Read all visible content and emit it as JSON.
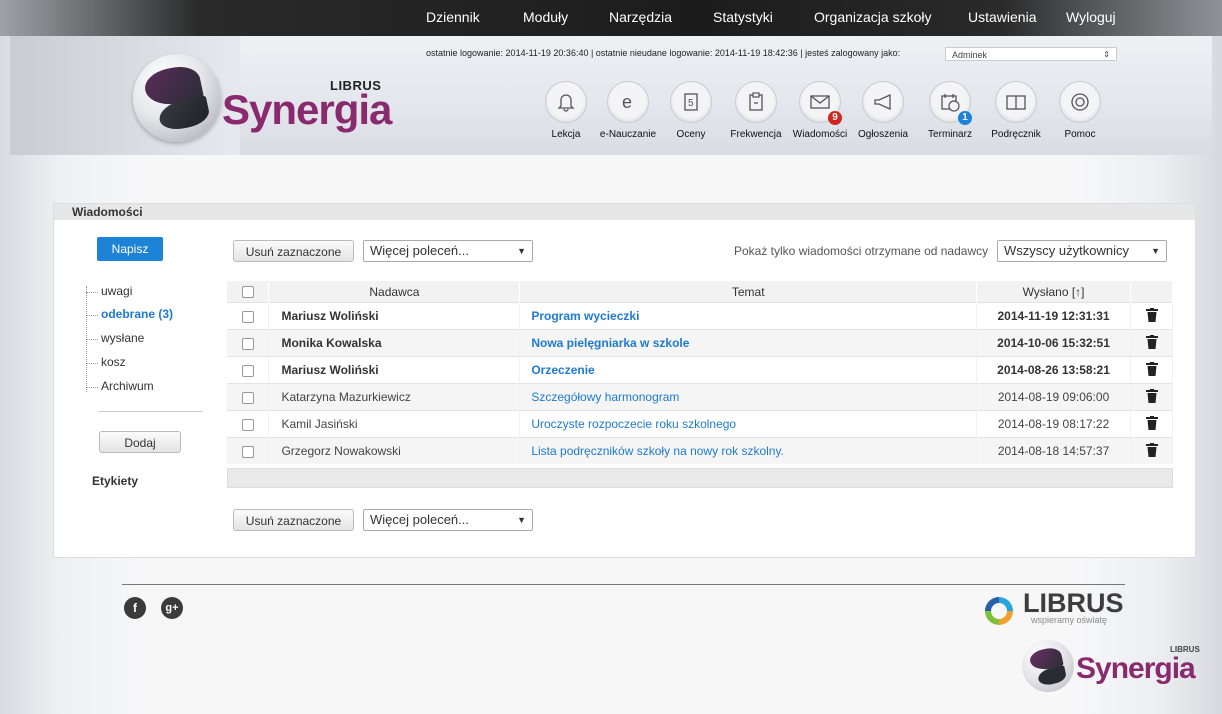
{
  "top_nav": [
    "Dziennik",
    "Moduły",
    "Narzędzia",
    "Statystyki",
    "Organizacja szkoły",
    "Ustawienia",
    "Wyloguj"
  ],
  "login_info": {
    "text": "ostatnie logowanie: 2014-11-19 20:36:40  |  ostatnie nieudane logowanie: 2014-11-19 18:42:36  |  jesteś zalogowany jako:",
    "user": "Adminek"
  },
  "brand": {
    "librus": "LIBRUS",
    "synergia": "Synergia"
  },
  "modules": [
    {
      "label": "Lekcja",
      "icon": "bell-icon"
    },
    {
      "label": "e-Nauczanie",
      "icon": "e-icon"
    },
    {
      "label": "Oceny",
      "icon": "grade-icon"
    },
    {
      "label": "Frekwencja",
      "icon": "clipboard-icon"
    },
    {
      "label": "Wiadomości",
      "icon": "envelope-icon",
      "badge": "9",
      "badge_color": "#d0261f"
    },
    {
      "label": "Ogłoszenia",
      "icon": "megaphone-icon"
    },
    {
      "label": "Terminarz",
      "icon": "calendar-icon",
      "badge": "1",
      "badge_color": "#1e83d7"
    },
    {
      "label": "Podręcznik",
      "icon": "book-icon"
    },
    {
      "label": "Pomoc",
      "icon": "lifebuoy-icon"
    }
  ],
  "panel": {
    "title": "Wiadomości",
    "compose": "Napisz",
    "folders": [
      {
        "label": "uwagi",
        "active": false
      },
      {
        "label": "odebrane (3)",
        "active": true
      },
      {
        "label": "wysłane",
        "active": false
      },
      {
        "label": "kosz",
        "active": false
      },
      {
        "label": "Archiwum",
        "active": false
      }
    ],
    "add_label": "Dodaj",
    "labels_heading": "Etykiety",
    "delete_selected": "Usuń zaznaczone",
    "more_actions": "Więcej poleceń...",
    "filter_label": "Pokaż tylko wiadomości otrzymane od nadawcy",
    "filter_value": "Wszyscy użytkownicy",
    "columns": {
      "sender": "Nadawca",
      "topic": "Temat",
      "sent": "Wysłano [↑]"
    },
    "messages": [
      {
        "sender": "Mariusz Woliński",
        "topic": "Program wycieczki",
        "sent": "2014-11-19 12:31:31",
        "unread": true
      },
      {
        "sender": "Monika Kowalska",
        "topic": "Nowa pielęgniarka w szkole",
        "sent": "2014-10-06 15:32:51",
        "unread": true
      },
      {
        "sender": "Mariusz Woliński",
        "topic": "Orzeczenie",
        "sent": "2014-08-26 13:58:21",
        "unread": true
      },
      {
        "sender": "Katarzyna Mazurkiewicz",
        "topic": "Szczegółowy harmonogram",
        "sent": "2014-08-19 09:06:00",
        "unread": false
      },
      {
        "sender": "Kamil Jasiński",
        "topic": "Uroczyste rozpoczecie roku szkolnego",
        "sent": "2014-08-19 08:17:22",
        "unread": false
      },
      {
        "sender": "Grzegorz Nowakowski",
        "topic": "Lista podręczników szkoły na nowy rok szkolny.",
        "sent": "2014-08-18 14:57:37",
        "unread": false
      }
    ]
  },
  "footer": {
    "facebook": "f",
    "gplus": "g+",
    "librus": "LIBRUS",
    "tagline": "wspieramy oświatę",
    "synergia": "Synergia",
    "synergia_librus": "LIBRUS"
  }
}
